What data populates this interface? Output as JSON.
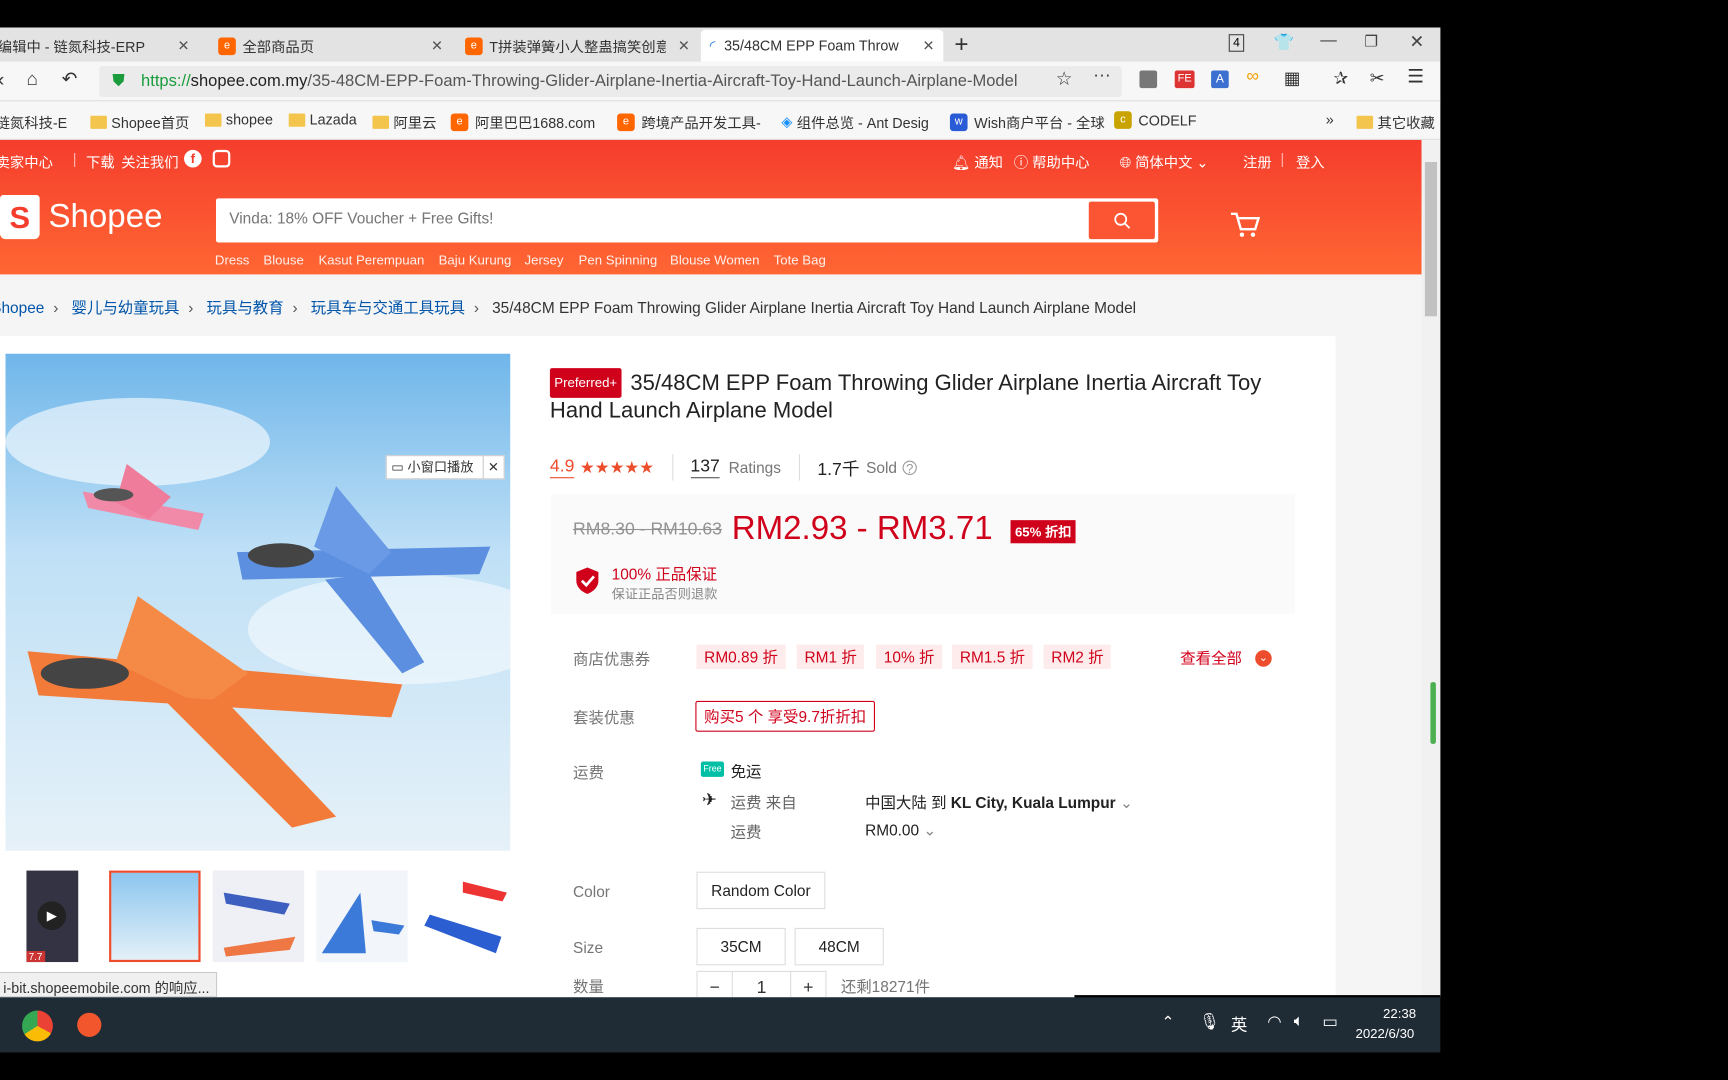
{
  "browser": {
    "tabs": [
      {
        "label": "编辑中 - 链氮科技-ERP",
        "active": false
      },
      {
        "label": "全部商品页",
        "active": false
      },
      {
        "label": "T拼装弹簧小人整蛊搞笑创意",
        "active": false
      },
      {
        "label": "35/48CM EPP Foam Throw",
        "active": true
      }
    ],
    "window_badge": "4",
    "url_scheme": "https://",
    "url_host": "shopee.com.my",
    "url_path": "/35-48CM-EPP-Foam-Throwing-Glider-Airplane-Inertia-Aircraft-Toy-Hand-Launch-Airplane-Model",
    "bookmarks": [
      "链氮科技-E",
      "Shopee首页",
      "shopee",
      "Lazada",
      "阿里云",
      "阿里巴巴1688.com",
      "跨境产品开发工具-",
      "组件总览 - Ant Desig",
      "Wish商户平台 - 全球",
      "CODELF"
    ],
    "bookmarks_more": "»",
    "other_bookmarks": "其它收藏",
    "status_text": "i-bit.shopeemobile.com 的响应..."
  },
  "shopee": {
    "topnav_left": [
      "卖家中心",
      "下载",
      "关注我们"
    ],
    "topnav_right": {
      "notify": "通知",
      "help": "帮助中心",
      "language": "简体中文",
      "register": "注册",
      "login": "登入"
    },
    "logo": "Shopee",
    "search_placeholder": "Vinda: 18% OFF Voucher + Free Gifts!",
    "keywords": [
      "Dress",
      "Blouse",
      "Kasut Perempuan",
      "Baju Kurung",
      "Jersey",
      "Pen Spinning",
      "Blouse Women",
      "Tote Bag"
    ],
    "breadcrumb": [
      "Shopee",
      "婴儿与幼童玩具",
      "玩具与教育",
      "玩具车与交通工具玩具"
    ],
    "breadcrumb_current": "35/48CM EPP Foam Throwing Glider Airplane Inertia Aircraft Toy Hand Launch Airplane Model"
  },
  "product": {
    "badge": "Preferred+",
    "title": "35/48CM EPP Foam Throwing Glider Airplane Inertia Aircraft Toy Hand Launch Airplane Model",
    "rating": "4.9",
    "stars": 5,
    "ratings_count": "137",
    "ratings_label": "Ratings",
    "sold": "1.7千",
    "sold_label": "Sold",
    "original_price": "RM8.30 - RM10.63",
    "price": "RM2.93 - RM3.71",
    "discount": "65% 折扣",
    "guarantee_title": "100% 正品保证",
    "guarantee_sub": "保证正品否则退款",
    "mini_player": "小窗口播放",
    "thumb_badge": "7.7",
    "vouchers_label": "商店优惠券",
    "vouchers": [
      "RM0.89 折",
      "RM1 折",
      "10% 折",
      "RM1.5 折",
      "RM2 折"
    ],
    "see_all": "查看全部",
    "bundle_label": "套装优惠",
    "bundle": "购买5 个 享受9.7折折扣",
    "shipping_label": "运费",
    "free_shipping_badge": "Free",
    "free_shipping": "免运",
    "ship_from_label": "运费 来自",
    "ship_from": "中国大陆",
    "ship_to_word": "到",
    "ship_to": "KL City, Kuala Lumpur",
    "ship_fee_label": "运费",
    "ship_fee": "RM0.00",
    "color_label": "Color",
    "colors": [
      "Random Color"
    ],
    "size_label": "Size",
    "sizes": [
      "35CM",
      "48CM"
    ],
    "qty_label": "数量",
    "qty": "1",
    "stock": "还剩18271件"
  },
  "taskbar": {
    "ime": "英",
    "time": "22:38",
    "date": "2022/6/30"
  },
  "colors": {
    "brand": "#ee4d2d",
    "price": "#d0011b"
  }
}
